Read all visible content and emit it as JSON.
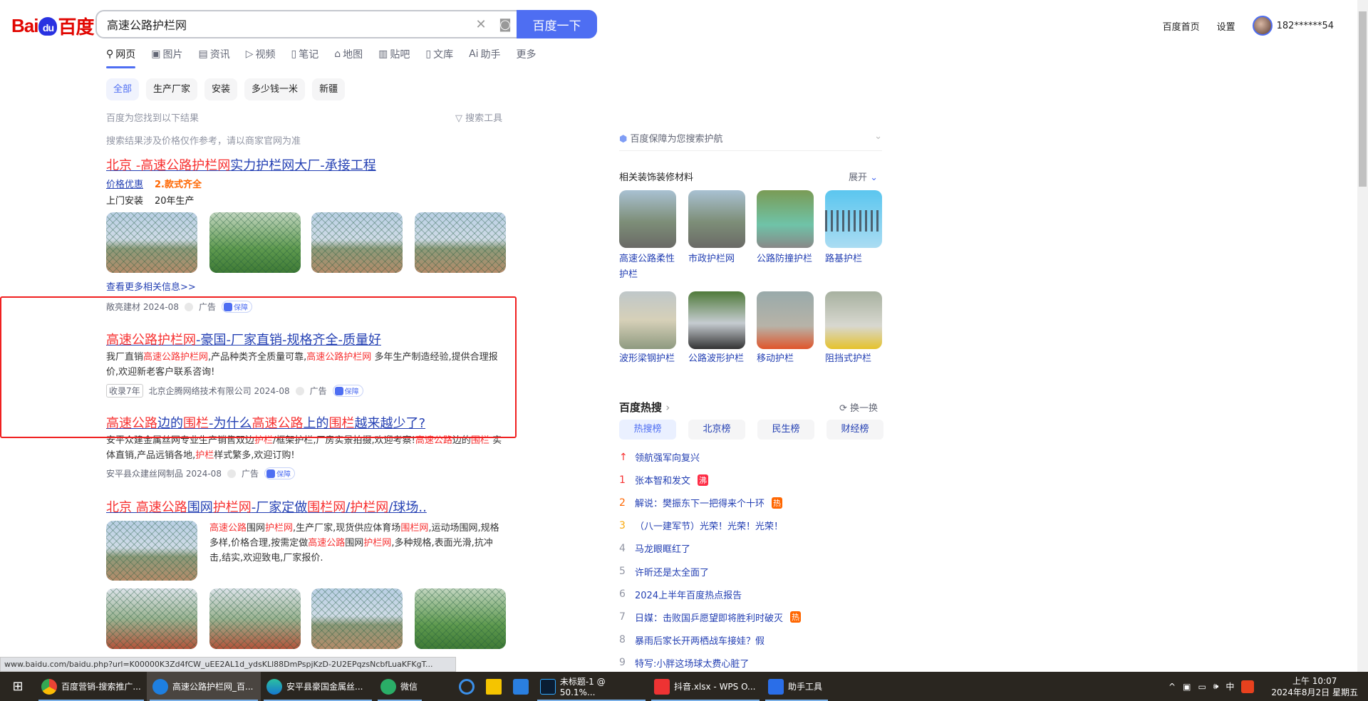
{
  "header": {
    "logo": "Bai du 百度",
    "query": "高速公路护栏网",
    "submit": "百度一下",
    "home": "百度首页",
    "settings": "设置",
    "user": "182******54"
  },
  "tabs": [
    "网页",
    "图片",
    "资讯",
    "视频",
    "笔记",
    "地图",
    "贴吧",
    "文库",
    "助手",
    "更多"
  ],
  "chips": [
    "全部",
    "生产厂家",
    "安装",
    "多少钱一米",
    "新疆"
  ],
  "info": {
    "found": "百度为您找到以下结果",
    "tools": "搜索工具",
    "notice": "搜索结果涉及价格仅作参考，请以商家官网为准"
  },
  "results": [
    {
      "title_hl": "北京 -高速公路护栏网",
      "title_rest": "实力护栏网大厂-承接工程",
      "link1": "价格优惠",
      "link2": "2.款式齐全",
      "sub1": "上门安装",
      "sub2": "20年生产",
      "more": "查看更多相关信息>>",
      "source": "敞亮建材 2024-08",
      "ad": "广告",
      "badge": "保障"
    },
    {
      "t1": "高速公路护栏网",
      "t2": "-豪国-厂家直销-规格齐全-质量好",
      "d1": "我厂直销",
      "d2": "高速公路护栏网",
      "d3": ",产品种类齐全质量可靠,",
      "d4": "高速公路护栏网",
      "d5": " 多年生产制造经验,提供合理报价,欢迎新老客户联系咨询!",
      "years": "收录7年",
      "source": "北京企腾网络技术有限公司 2024-08",
      "ad": "广告",
      "badge": "保障"
    },
    {
      "t1": "高速公路",
      "t2": "边的",
      "t3": "围栏",
      "t4": "-为什么",
      "t5": "高速公路",
      "t6": "上的",
      "t7": "围栏",
      "t8": "越来越少了?",
      "d1": "安平众建金属丝网专业生产销售双边",
      "d2": "护栏",
      "d3": "/框架护栏,厂房实景拍摄,欢迎考察!",
      "d4": "高速公路",
      "d5": "边的",
      "d6": "围栏",
      "d7": " 实体直销,产品远销各地,",
      "d8": "护栏",
      "d9": "样式繁多,欢迎订购!",
      "source": "安平县众建丝网制品 2024-08",
      "ad": "广告",
      "badge": "保障"
    },
    {
      "t1": "北京 高速公路",
      "t2": "围网",
      "t3": "护栏网",
      "t4": "-厂家定做",
      "t5": "围栏网",
      "t6": "/",
      "t7": "护栏网",
      "t8": "/球场..",
      "d1": "高速公路",
      "d2": "围网",
      "d3": "护栏网",
      "d4": ",生产厂家,现货供应体育场",
      "d5": "围栏网",
      "d6": ",运动场围网,规格多样,价格合理,按需定做",
      "d7": "高速公路",
      "d8": "围网",
      "d9": "护栏网",
      "d10": ",多种规格,表面光滑,抗冲击,结实,欢迎致电,厂家报价."
    }
  ],
  "right": {
    "guard": "百度保障为您搜索护航",
    "related_title": "相关装饰装修材料",
    "expand": "展开",
    "related": [
      "高速公路柔性护栏",
      "市政护栏网",
      "公路防撞护栏",
      "路基护栏",
      "波形梁钢护栏",
      "公路波形护栏",
      "移动护栏",
      "阻挡式护栏"
    ],
    "hot_title": "百度热搜",
    "refresh": "换一换",
    "hot_tabs": [
      "热搜榜",
      "北京榜",
      "民生榜",
      "财经榜"
    ],
    "hot": [
      {
        "n": "↑",
        "t": "领航强军向复兴",
        "tag": ""
      },
      {
        "n": "1",
        "t": "张本智和发文",
        "tag": "沸"
      },
      {
        "n": "2",
        "t": "解说：樊振东下一把得来个十环",
        "tag": "热"
      },
      {
        "n": "3",
        "t": "（八一建军节）光荣！光荣！光荣！",
        "tag": ""
      },
      {
        "n": "4",
        "t": "马龙眼眶红了",
        "tag": ""
      },
      {
        "n": "5",
        "t": "许昕还是太全面了",
        "tag": ""
      },
      {
        "n": "6",
        "t": "2024上半年百度热点报告",
        "tag": ""
      },
      {
        "n": "7",
        "t": "日媒：击败国乒愿望即将胜利时破灭",
        "tag": "热"
      },
      {
        "n": "8",
        "t": "暴雨后家长开两栖战车接娃？假",
        "tag": ""
      },
      {
        "n": "9",
        "t": "特写:小胖这场球太费心脏了",
        "tag": ""
      }
    ]
  },
  "status_url": "www.baidu.com/baidu.php?url=K00000K3Zd4fCW_uEE2AL1d_ydsKLl88DmPspjKzD-2U2EPqzsNcbfLuaKFKgT...",
  "taskbar": {
    "items": [
      "百度营销-搜索推广...",
      "高速公路护栏网_百...",
      "安平县豪国金属丝...",
      "微信",
      "未标题-1 @ 50.1%...",
      "抖音.xlsx - WPS O...",
      "助手工具"
    ],
    "ime": "中",
    "time": "上午 10:07",
    "date": "2024年8月2日 星期五"
  },
  "colors": {
    "accent": "#4e6ef2",
    "highlight": "#f73131",
    "link": "#2440b3",
    "annotation": "#f02020"
  }
}
